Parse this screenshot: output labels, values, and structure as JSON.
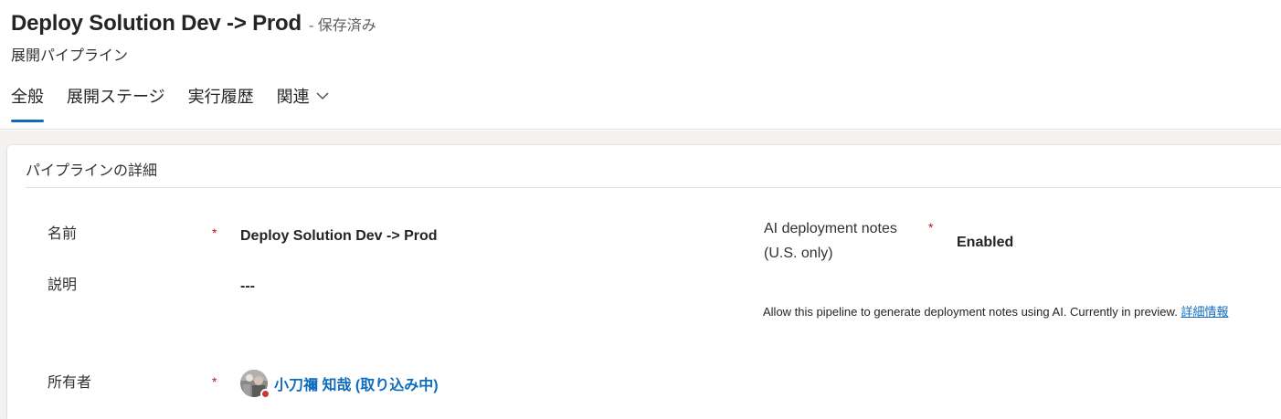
{
  "header": {
    "title": "Deploy Solution Dev -> Prod",
    "save_status": "- 保存済み",
    "entity_type": "展開パイプライン"
  },
  "tabs": [
    {
      "label": "全般",
      "active": true
    },
    {
      "label": "展開ステージ",
      "active": false
    },
    {
      "label": "実行履歴",
      "active": false
    },
    {
      "label": "関連",
      "active": false,
      "has_dropdown": true
    }
  ],
  "section": {
    "title": "パイプラインの詳細"
  },
  "fields": {
    "name": {
      "label": "名前",
      "required_mark": "*",
      "value": "Deploy Solution Dev -> Prod"
    },
    "description": {
      "label": "説明",
      "value": "---"
    },
    "owner": {
      "label": "所有者",
      "required_mark": "*",
      "value": "小刀禰 知哉 (取り込み中)",
      "presence": "busy"
    },
    "ai_notes": {
      "label_line1": "AI deployment notes",
      "label_line2": "(U.S. only)",
      "required_mark": "*",
      "value": "Enabled",
      "help_text": "Allow this pipeline to generate deployment notes using AI. Currently in preview. ",
      "help_link": "詳細情報"
    }
  },
  "colors": {
    "accent": "#0f6cbd",
    "required": "#c50f1f",
    "presence_busy": "#d13438",
    "canvas_bg": "#f3f2f1"
  }
}
